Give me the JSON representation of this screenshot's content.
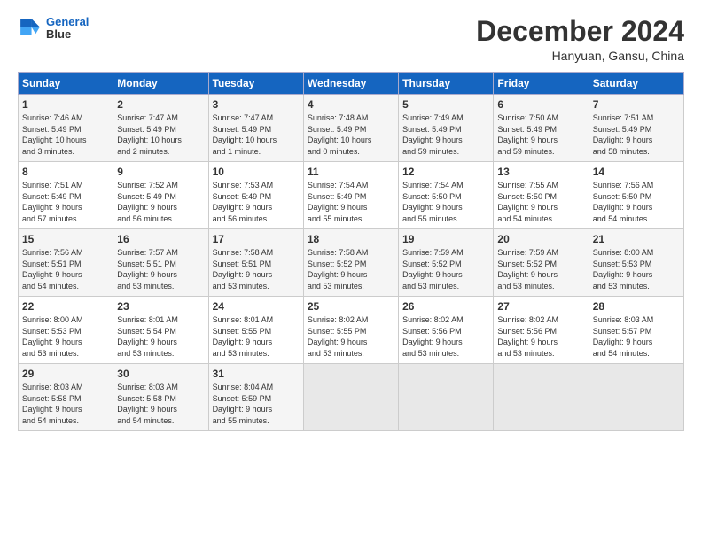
{
  "header": {
    "logo_line1": "General",
    "logo_line2": "Blue",
    "month_title": "December 2024",
    "location": "Hanyuan, Gansu, China"
  },
  "days_of_week": [
    "Sunday",
    "Monday",
    "Tuesday",
    "Wednesday",
    "Thursday",
    "Friday",
    "Saturday"
  ],
  "weeks": [
    [
      {
        "day": "1",
        "info": "Sunrise: 7:46 AM\nSunset: 5:49 PM\nDaylight: 10 hours\nand 3 minutes."
      },
      {
        "day": "2",
        "info": "Sunrise: 7:47 AM\nSunset: 5:49 PM\nDaylight: 10 hours\nand 2 minutes."
      },
      {
        "day": "3",
        "info": "Sunrise: 7:47 AM\nSunset: 5:49 PM\nDaylight: 10 hours\nand 1 minute."
      },
      {
        "day": "4",
        "info": "Sunrise: 7:48 AM\nSunset: 5:49 PM\nDaylight: 10 hours\nand 0 minutes."
      },
      {
        "day": "5",
        "info": "Sunrise: 7:49 AM\nSunset: 5:49 PM\nDaylight: 9 hours\nand 59 minutes."
      },
      {
        "day": "6",
        "info": "Sunrise: 7:50 AM\nSunset: 5:49 PM\nDaylight: 9 hours\nand 59 minutes."
      },
      {
        "day": "7",
        "info": "Sunrise: 7:51 AM\nSunset: 5:49 PM\nDaylight: 9 hours\nand 58 minutes."
      }
    ],
    [
      {
        "day": "8",
        "info": "Sunrise: 7:51 AM\nSunset: 5:49 PM\nDaylight: 9 hours\nand 57 minutes."
      },
      {
        "day": "9",
        "info": "Sunrise: 7:52 AM\nSunset: 5:49 PM\nDaylight: 9 hours\nand 56 minutes."
      },
      {
        "day": "10",
        "info": "Sunrise: 7:53 AM\nSunset: 5:49 PM\nDaylight: 9 hours\nand 56 minutes."
      },
      {
        "day": "11",
        "info": "Sunrise: 7:54 AM\nSunset: 5:49 PM\nDaylight: 9 hours\nand 55 minutes."
      },
      {
        "day": "12",
        "info": "Sunrise: 7:54 AM\nSunset: 5:50 PM\nDaylight: 9 hours\nand 55 minutes."
      },
      {
        "day": "13",
        "info": "Sunrise: 7:55 AM\nSunset: 5:50 PM\nDaylight: 9 hours\nand 54 minutes."
      },
      {
        "day": "14",
        "info": "Sunrise: 7:56 AM\nSunset: 5:50 PM\nDaylight: 9 hours\nand 54 minutes."
      }
    ],
    [
      {
        "day": "15",
        "info": "Sunrise: 7:56 AM\nSunset: 5:51 PM\nDaylight: 9 hours\nand 54 minutes."
      },
      {
        "day": "16",
        "info": "Sunrise: 7:57 AM\nSunset: 5:51 PM\nDaylight: 9 hours\nand 53 minutes."
      },
      {
        "day": "17",
        "info": "Sunrise: 7:58 AM\nSunset: 5:51 PM\nDaylight: 9 hours\nand 53 minutes."
      },
      {
        "day": "18",
        "info": "Sunrise: 7:58 AM\nSunset: 5:52 PM\nDaylight: 9 hours\nand 53 minutes."
      },
      {
        "day": "19",
        "info": "Sunrise: 7:59 AM\nSunset: 5:52 PM\nDaylight: 9 hours\nand 53 minutes."
      },
      {
        "day": "20",
        "info": "Sunrise: 7:59 AM\nSunset: 5:52 PM\nDaylight: 9 hours\nand 53 minutes."
      },
      {
        "day": "21",
        "info": "Sunrise: 8:00 AM\nSunset: 5:53 PM\nDaylight: 9 hours\nand 53 minutes."
      }
    ],
    [
      {
        "day": "22",
        "info": "Sunrise: 8:00 AM\nSunset: 5:53 PM\nDaylight: 9 hours\nand 53 minutes."
      },
      {
        "day": "23",
        "info": "Sunrise: 8:01 AM\nSunset: 5:54 PM\nDaylight: 9 hours\nand 53 minutes."
      },
      {
        "day": "24",
        "info": "Sunrise: 8:01 AM\nSunset: 5:55 PM\nDaylight: 9 hours\nand 53 minutes."
      },
      {
        "day": "25",
        "info": "Sunrise: 8:02 AM\nSunset: 5:55 PM\nDaylight: 9 hours\nand 53 minutes."
      },
      {
        "day": "26",
        "info": "Sunrise: 8:02 AM\nSunset: 5:56 PM\nDaylight: 9 hours\nand 53 minutes."
      },
      {
        "day": "27",
        "info": "Sunrise: 8:02 AM\nSunset: 5:56 PM\nDaylight: 9 hours\nand 53 minutes."
      },
      {
        "day": "28",
        "info": "Sunrise: 8:03 AM\nSunset: 5:57 PM\nDaylight: 9 hours\nand 54 minutes."
      }
    ],
    [
      {
        "day": "29",
        "info": "Sunrise: 8:03 AM\nSunset: 5:58 PM\nDaylight: 9 hours\nand 54 minutes."
      },
      {
        "day": "30",
        "info": "Sunrise: 8:03 AM\nSunset: 5:58 PM\nDaylight: 9 hours\nand 54 minutes."
      },
      {
        "day": "31",
        "info": "Sunrise: 8:04 AM\nSunset: 5:59 PM\nDaylight: 9 hours\nand 55 minutes."
      },
      {
        "day": "",
        "info": ""
      },
      {
        "day": "",
        "info": ""
      },
      {
        "day": "",
        "info": ""
      },
      {
        "day": "",
        "info": ""
      }
    ]
  ]
}
